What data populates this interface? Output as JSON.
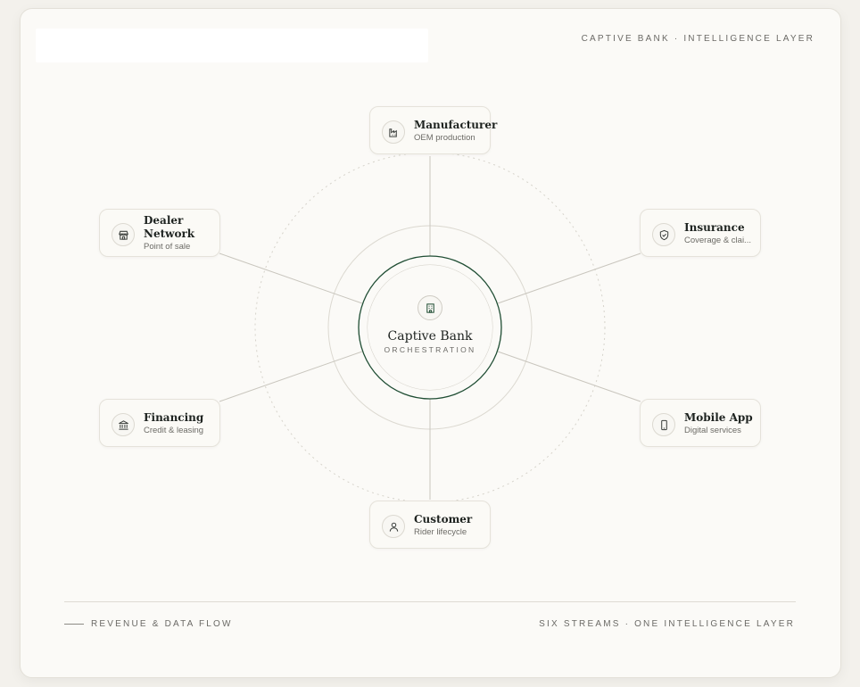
{
  "header": {
    "title": "",
    "tag": "CAPTIVE BANK · INTELLIGENCE LAYER"
  },
  "hub": {
    "name": "Captive Bank",
    "subtitle": "ORCHESTRATION",
    "icon": "bank-building-icon",
    "accent_color": "#1f4d33"
  },
  "nodes": {
    "manufacturer": {
      "name": "Manufacturer",
      "subtitle": "OEM production",
      "icon": "factory-icon"
    },
    "insurance": {
      "name": "Insurance",
      "subtitle": "Coverage & clai...",
      "icon": "shield-icon"
    },
    "mobile_app": {
      "name": "Mobile App",
      "subtitle": "Digital services",
      "icon": "phone-icon"
    },
    "customer": {
      "name": "Customer",
      "subtitle": "Rider lifecycle",
      "icon": "person-icon"
    },
    "financing": {
      "name": "Financing",
      "subtitle": "Credit & leasing",
      "icon": "bank-icon"
    },
    "dealer_network": {
      "name": "Dealer Network",
      "subtitle": "Point of sale",
      "icon": "storefront-icon"
    }
  },
  "footer": {
    "legend": "REVENUE & DATA FLOW",
    "summary": "SIX STREAMS · ONE INTELLIGENCE LAYER"
  }
}
